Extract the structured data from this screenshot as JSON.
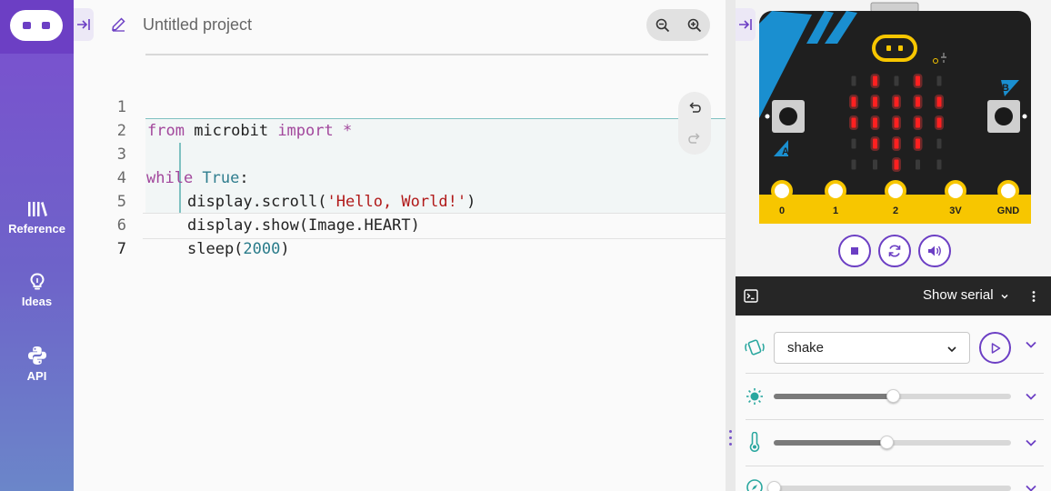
{
  "sidebar": {
    "items": [
      {
        "label": "Reference",
        "icon": "books-icon"
      },
      {
        "label": "Ideas",
        "icon": "lightbulb-icon"
      },
      {
        "label": "API",
        "icon": "python-icon"
      }
    ]
  },
  "editor": {
    "project_name": "Untitled project",
    "active_line": 7,
    "lines": [
      {
        "n": "1"
      },
      {
        "n": "2"
      },
      {
        "n": "3"
      },
      {
        "n": "4"
      },
      {
        "n": "5"
      },
      {
        "n": "6"
      },
      {
        "n": "7"
      }
    ],
    "code": {
      "l1_kw1": "from",
      "l1_mod": " microbit ",
      "l1_kw2": "import",
      "l1_star": " *",
      "l3_kw": "while",
      "l3_true": " True",
      "l3_colon": ":",
      "l4_a": "display.scroll(",
      "l4_str": "'Hello, World!'",
      "l4_b": ")",
      "l5": "display.show(Image.HEART)",
      "l6_a": "sleep(",
      "l6_num": "2000",
      "l6_b": ")"
    }
  },
  "simulator": {
    "pins": [
      "0",
      "1",
      "2",
      "3V",
      "GND"
    ],
    "buttons": {
      "a": "A",
      "b": "B"
    },
    "led_grid": [
      [
        0,
        1,
        0,
        1,
        0
      ],
      [
        1,
        1,
        1,
        1,
        1
      ],
      [
        1,
        1,
        1,
        1,
        1
      ],
      [
        0,
        1,
        1,
        1,
        0
      ],
      [
        0,
        0,
        1,
        0,
        0
      ]
    ]
  },
  "serial": {
    "label": "Show serial"
  },
  "sensors": {
    "gesture": {
      "value": "shake"
    },
    "light_level": 0.5,
    "temperature_level": 0.475,
    "compass_level": 0.0
  },
  "colors": {
    "brand": "#6c3fc4",
    "keyword": "#a2479c",
    "string": "#b11a1a",
    "number": "#297b8a",
    "led_on": "#ff2020",
    "board_yellow": "#f7c600"
  }
}
